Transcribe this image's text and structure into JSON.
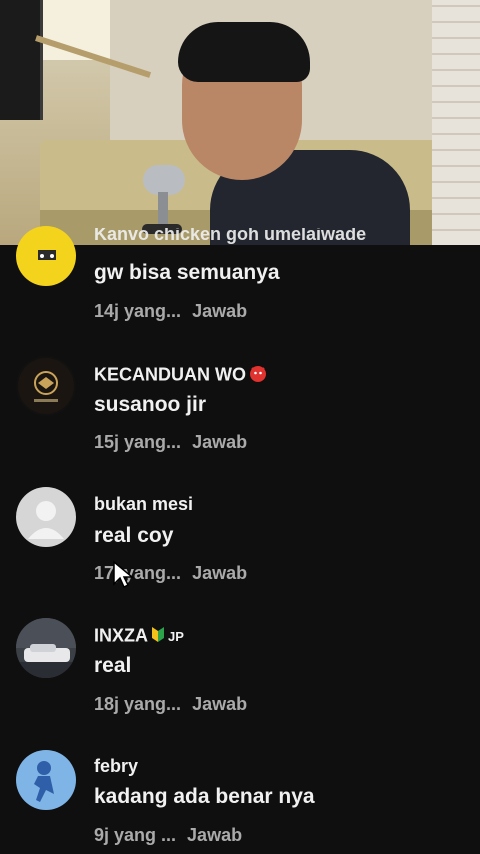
{
  "comments": [
    {
      "author": "Kanvo chicken goh umelaiwade",
      "text": "gw bisa semuanya",
      "time": "14j yang...",
      "reply": "Jawab",
      "avatar": "yellow-cartoon-avatar"
    },
    {
      "author": "KECANDUAN WO",
      "text": "susanoo jir",
      "time": "15j yang...",
      "reply": "Jawab",
      "avatar": "dark-logo-avatar",
      "badge": "red-devil-emoji"
    },
    {
      "author": "bukan mesi",
      "text": "real coy",
      "time": "17j yang...",
      "reply": "Jawab",
      "avatar": "default-person-avatar"
    },
    {
      "author": "INXZA",
      "text": "real",
      "time": "18j yang...",
      "reply": "Jawab",
      "avatar": "car-photo-avatar",
      "badge": "beginner-symbol-emoji",
      "suffix": "JP"
    },
    {
      "author": "febry",
      "text": "kadang ada benar nya",
      "time": "9j yang ...",
      "reply": "Jawab",
      "avatar": "blue-figure-avatar"
    }
  ],
  "colors": {
    "background": "#0f0f0f",
    "primary_text": "#f1f1f1",
    "secondary_text": "#aaaaaa"
  }
}
